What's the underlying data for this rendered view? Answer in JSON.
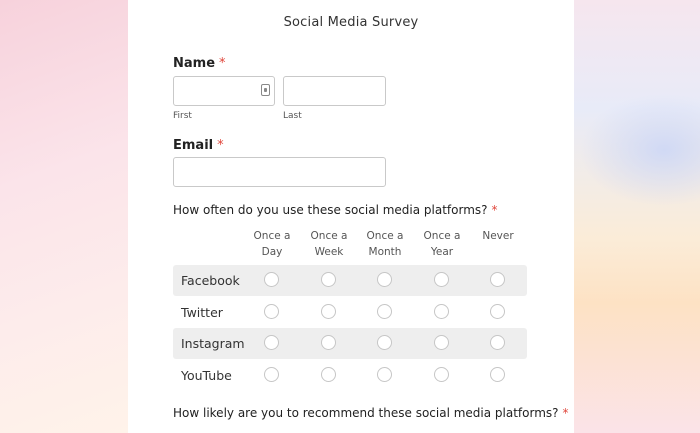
{
  "form": {
    "title": "Social Media Survey",
    "name": {
      "label": "Name",
      "required_mark": "*",
      "first": {
        "value": "",
        "sublabel": "First"
      },
      "last": {
        "value": "",
        "sublabel": "Last"
      }
    },
    "email": {
      "label": "Email",
      "required_mark": "*",
      "value": ""
    },
    "usage_question": {
      "text": "How often do you use these social media platforms?",
      "required_mark": "*",
      "columns": [
        {
          "line1": "Once a",
          "line2": "Day"
        },
        {
          "line1": "Once a",
          "line2": "Week"
        },
        {
          "line1": "Once a",
          "line2": "Month"
        },
        {
          "line1": "Once a",
          "line2": "Year"
        },
        {
          "line1": "",
          "line2": "Never"
        }
      ],
      "rows": [
        "Facebook",
        "Twitter",
        "Instagram",
        "YouTube"
      ]
    },
    "recommend_question": {
      "text": "How likely are you to recommend these social media platforms?",
      "required_mark": "*"
    }
  },
  "colors": {
    "required": "#e0453a",
    "row_shade": "#eeeeee",
    "input_border": "#c9c9c9"
  }
}
